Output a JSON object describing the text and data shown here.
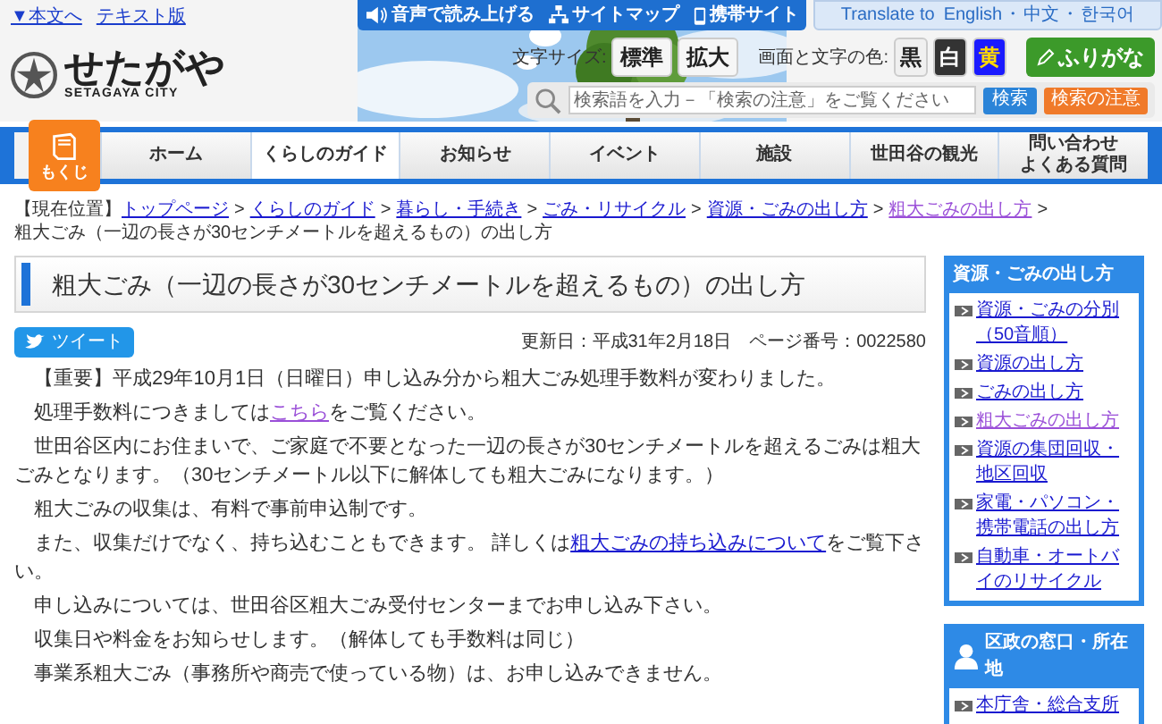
{
  "skip_links": [
    {
      "label": "▼本文へ"
    },
    {
      "label": "テキスト版"
    }
  ],
  "logo": {
    "name": "せたがや",
    "subtitle": "SETAGAYA CITY"
  },
  "top_buttons": [
    {
      "label": "音声で読み上げる",
      "kind": "speaker"
    },
    {
      "label": "サイトマップ",
      "kind": "sitemap"
    },
    {
      "label": "携帯サイト",
      "kind": "mobile"
    }
  ],
  "translate": {
    "label": "Translate to",
    "languages": [
      "English",
      "中文",
      "한국어"
    ],
    "separator": "・"
  },
  "font_size": {
    "label": "文字サイズ:",
    "buttons": [
      "標準",
      "拡大"
    ]
  },
  "color_scheme": {
    "label": "画面と文字の色:",
    "options": [
      {
        "label": "黒",
        "color": "#f0f0f0"
      },
      {
        "label": "白",
        "color": "#333333"
      },
      {
        "label": "黄",
        "color": "#1a1aff"
      }
    ]
  },
  "furigana": {
    "label": "ふりがな"
  },
  "search": {
    "placeholder": "検索語を入力－「検索の注意」をご覧ください",
    "button": "検索",
    "notes_button": "検索の注意"
  },
  "contents_button": {
    "label": "もくじ"
  },
  "nav": [
    {
      "lines": [
        "ホーム"
      ],
      "selected": false
    },
    {
      "lines": [
        "くらしのガイド"
      ],
      "selected": true
    },
    {
      "lines": [
        "お知らせ"
      ],
      "selected": false
    },
    {
      "lines": [
        "イベント"
      ],
      "selected": false
    },
    {
      "lines": [
        "施設"
      ],
      "selected": false
    },
    {
      "lines": [
        "世田谷の観光"
      ],
      "selected": false
    },
    {
      "lines": [
        "問い合わせ",
        "よくある質問"
      ],
      "selected": false
    }
  ],
  "breadcrumb": {
    "label": "【現在位置】",
    "separator": ">",
    "links": [
      {
        "label": "トップページ",
        "visited": false
      },
      {
        "label": "くらしのガイド",
        "visited": false
      },
      {
        "label": "暮らし・手続き",
        "visited": false
      },
      {
        "label": "ごみ・リサイクル",
        "visited": false
      },
      {
        "label": "資源・ごみの出し方",
        "visited": false
      },
      {
        "label": "粗大ごみの出し方",
        "visited": true
      }
    ],
    "current": "粗大ごみ（一辺の長さが30センチメートルを超えるもの）の出し方"
  },
  "title": "粗大ごみ（一辺の長さが30センチメートルを超えるもの）の出し方",
  "tweet_button": "ツイート",
  "updated": "更新日：平成31年2月18日",
  "page_number": "ページ番号：0022580",
  "paragraphs": [
    {
      "text": "【重要】平成29年10月1日（日曜日）申し込み分から粗大ごみ処理手数料が変わりました。"
    },
    {
      "text": "処理手数料につきましては",
      "link": "こちら",
      "link_visited": true,
      "after": "をご覧ください。"
    },
    {
      "text": "世田谷区内にお住まいで、ご家庭で不要となった一辺の長さが30センチメートルを超えるごみは粗大ごみとなります。（30センチメートル以下に解体しても粗大ごみになります。）"
    },
    {
      "text": "粗大ごみの収集は、有料で事前申込制です。"
    },
    {
      "text": "また、収集だけでなく、持ち込むこともできます。 詳しくは",
      "link": "粗大ごみの持ち込みについて",
      "link_visited": false,
      "after": "をご覧下さい。"
    },
    {
      "text": "申し込みについては、世田谷区粗大ごみ受付センターまでお申し込み下さい。"
    },
    {
      "text": "収集日や料金をお知らせします。（解体しても手数料は同じ）"
    },
    {
      "text": "事業系粗大ごみ（事務所や商売で使っている物）は、お申し込みできません。"
    }
  ],
  "sidebar": [
    {
      "heading": "資源・ごみの出し方",
      "kind": "plain",
      "links": [
        {
          "label": "資源・ごみの分別（50音順）",
          "visited": false
        },
        {
          "label": "資源の出し方",
          "visited": false
        },
        {
          "label": "ごみの出し方",
          "visited": false
        },
        {
          "label": "粗大ごみの出し方",
          "visited": true
        },
        {
          "label": "資源の集団回収・地区回収",
          "visited": false
        },
        {
          "label": "家電・パソコン・携帯電話の出し方",
          "visited": false
        },
        {
          "label": "自動車・オートバイのリサイクル",
          "visited": false
        }
      ]
    },
    {
      "heading": "区政の窓口・所在地",
      "kind": "person",
      "links": [
        {
          "label": "本庁舎・総合支所",
          "visited": false
        }
      ]
    }
  ]
}
